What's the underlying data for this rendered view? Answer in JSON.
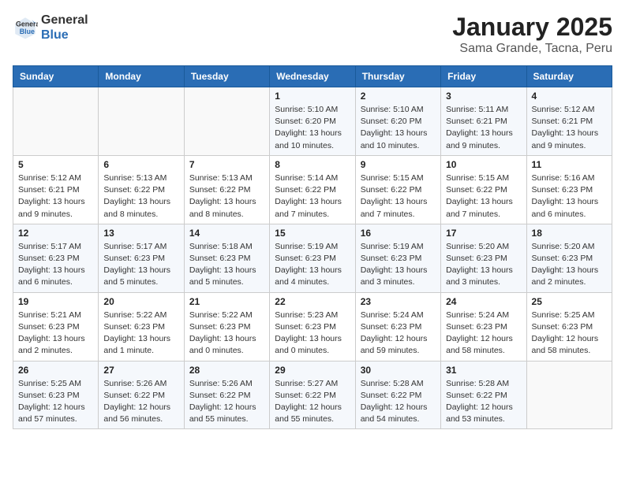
{
  "logo": {
    "line1": "General",
    "line2": "Blue"
  },
  "title": "January 2025",
  "subtitle": "Sama Grande, Tacna, Peru",
  "weekdays": [
    "Sunday",
    "Monday",
    "Tuesday",
    "Wednesday",
    "Thursday",
    "Friday",
    "Saturday"
  ],
  "weeks": [
    [
      {
        "day": "",
        "info": ""
      },
      {
        "day": "",
        "info": ""
      },
      {
        "day": "",
        "info": ""
      },
      {
        "day": "1",
        "info": "Sunrise: 5:10 AM\nSunset: 6:20 PM\nDaylight: 13 hours and 10 minutes."
      },
      {
        "day": "2",
        "info": "Sunrise: 5:10 AM\nSunset: 6:20 PM\nDaylight: 13 hours and 10 minutes."
      },
      {
        "day": "3",
        "info": "Sunrise: 5:11 AM\nSunset: 6:21 PM\nDaylight: 13 hours and 9 minutes."
      },
      {
        "day": "4",
        "info": "Sunrise: 5:12 AM\nSunset: 6:21 PM\nDaylight: 13 hours and 9 minutes."
      }
    ],
    [
      {
        "day": "5",
        "info": "Sunrise: 5:12 AM\nSunset: 6:21 PM\nDaylight: 13 hours and 9 minutes."
      },
      {
        "day": "6",
        "info": "Sunrise: 5:13 AM\nSunset: 6:22 PM\nDaylight: 13 hours and 8 minutes."
      },
      {
        "day": "7",
        "info": "Sunrise: 5:13 AM\nSunset: 6:22 PM\nDaylight: 13 hours and 8 minutes."
      },
      {
        "day": "8",
        "info": "Sunrise: 5:14 AM\nSunset: 6:22 PM\nDaylight: 13 hours and 7 minutes."
      },
      {
        "day": "9",
        "info": "Sunrise: 5:15 AM\nSunset: 6:22 PM\nDaylight: 13 hours and 7 minutes."
      },
      {
        "day": "10",
        "info": "Sunrise: 5:15 AM\nSunset: 6:22 PM\nDaylight: 13 hours and 7 minutes."
      },
      {
        "day": "11",
        "info": "Sunrise: 5:16 AM\nSunset: 6:23 PM\nDaylight: 13 hours and 6 minutes."
      }
    ],
    [
      {
        "day": "12",
        "info": "Sunrise: 5:17 AM\nSunset: 6:23 PM\nDaylight: 13 hours and 6 minutes."
      },
      {
        "day": "13",
        "info": "Sunrise: 5:17 AM\nSunset: 6:23 PM\nDaylight: 13 hours and 5 minutes."
      },
      {
        "day": "14",
        "info": "Sunrise: 5:18 AM\nSunset: 6:23 PM\nDaylight: 13 hours and 5 minutes."
      },
      {
        "day": "15",
        "info": "Sunrise: 5:19 AM\nSunset: 6:23 PM\nDaylight: 13 hours and 4 minutes."
      },
      {
        "day": "16",
        "info": "Sunrise: 5:19 AM\nSunset: 6:23 PM\nDaylight: 13 hours and 3 minutes."
      },
      {
        "day": "17",
        "info": "Sunrise: 5:20 AM\nSunset: 6:23 PM\nDaylight: 13 hours and 3 minutes."
      },
      {
        "day": "18",
        "info": "Sunrise: 5:20 AM\nSunset: 6:23 PM\nDaylight: 13 hours and 2 minutes."
      }
    ],
    [
      {
        "day": "19",
        "info": "Sunrise: 5:21 AM\nSunset: 6:23 PM\nDaylight: 13 hours and 2 minutes."
      },
      {
        "day": "20",
        "info": "Sunrise: 5:22 AM\nSunset: 6:23 PM\nDaylight: 13 hours and 1 minute."
      },
      {
        "day": "21",
        "info": "Sunrise: 5:22 AM\nSunset: 6:23 PM\nDaylight: 13 hours and 0 minutes."
      },
      {
        "day": "22",
        "info": "Sunrise: 5:23 AM\nSunset: 6:23 PM\nDaylight: 13 hours and 0 minutes."
      },
      {
        "day": "23",
        "info": "Sunrise: 5:24 AM\nSunset: 6:23 PM\nDaylight: 12 hours and 59 minutes."
      },
      {
        "day": "24",
        "info": "Sunrise: 5:24 AM\nSunset: 6:23 PM\nDaylight: 12 hours and 58 minutes."
      },
      {
        "day": "25",
        "info": "Sunrise: 5:25 AM\nSunset: 6:23 PM\nDaylight: 12 hours and 58 minutes."
      }
    ],
    [
      {
        "day": "26",
        "info": "Sunrise: 5:25 AM\nSunset: 6:23 PM\nDaylight: 12 hours and 57 minutes."
      },
      {
        "day": "27",
        "info": "Sunrise: 5:26 AM\nSunset: 6:22 PM\nDaylight: 12 hours and 56 minutes."
      },
      {
        "day": "28",
        "info": "Sunrise: 5:26 AM\nSunset: 6:22 PM\nDaylight: 12 hours and 55 minutes."
      },
      {
        "day": "29",
        "info": "Sunrise: 5:27 AM\nSunset: 6:22 PM\nDaylight: 12 hours and 55 minutes."
      },
      {
        "day": "30",
        "info": "Sunrise: 5:28 AM\nSunset: 6:22 PM\nDaylight: 12 hours and 54 minutes."
      },
      {
        "day": "31",
        "info": "Sunrise: 5:28 AM\nSunset: 6:22 PM\nDaylight: 12 hours and 53 minutes."
      },
      {
        "day": "",
        "info": ""
      }
    ]
  ]
}
